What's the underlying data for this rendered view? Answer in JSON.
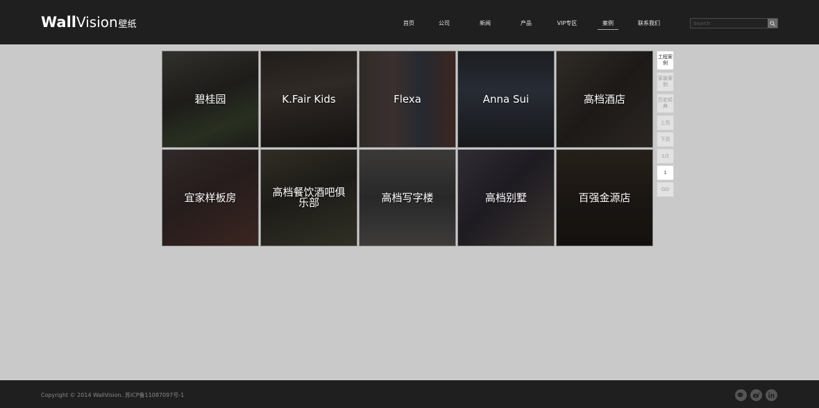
{
  "brand": {
    "part1": "Wall",
    "part2": "Vision",
    "suffix": "壁纸"
  },
  "nav": [
    {
      "label": "首页"
    },
    {
      "label": "公司"
    },
    {
      "label": "新闻"
    },
    {
      "label": "产品"
    },
    {
      "label": "VIP专区"
    },
    {
      "label": "案例",
      "active": true
    },
    {
      "label": "联系我们"
    }
  ],
  "search": {
    "placeholder": "Search",
    "icon": "search-icon"
  },
  "cases": [
    {
      "label": "碧桂园",
      "tone": "#3a3832"
    },
    {
      "label": "K.Fair Kids",
      "tone": "#2c2824"
    },
    {
      "label": "Flexa",
      "tone": "#3b3530"
    },
    {
      "label": "Anna Sui",
      "tone": "#22272e"
    },
    {
      "label": "高档酒店",
      "tone": "#35302b"
    },
    {
      "label": "宜家样板房",
      "tone": "#3a302c"
    },
    {
      "label": "高档餐饮酒吧俱乐部",
      "tone": "#36332a"
    },
    {
      "label": "高档写字楼",
      "tone": "#3a3a3c"
    },
    {
      "label": "高档别墅",
      "tone": "#343038"
    },
    {
      "label": "百强金源店",
      "tone": "#2c2620"
    }
  ],
  "side": {
    "categories": [
      "工程案例",
      "家装案例",
      "历史经典"
    ],
    "prev": "上页",
    "next": "下页",
    "page_info": "1/2",
    "page_input": "1",
    "go": "GO"
  },
  "footer": {
    "copyright": "Copyright © 2014 WallVision. 苏ICP备11087097号-1",
    "social": [
      "wechat-icon",
      "weibo-icon",
      "linkedin-icon"
    ]
  }
}
